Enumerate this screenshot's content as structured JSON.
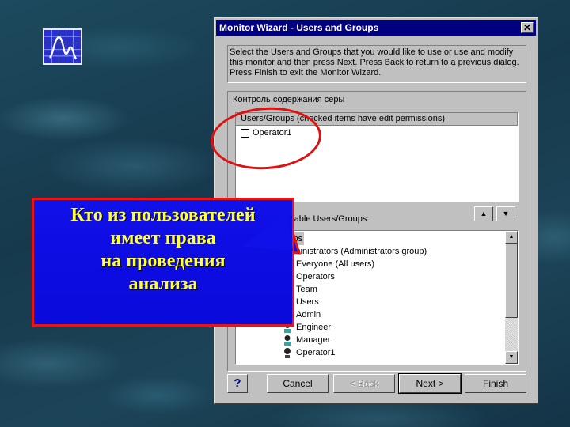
{
  "logo": {
    "icon": "waveform-chart-icon"
  },
  "dialog": {
    "title": "Monitor Wizard - Users and Groups",
    "close_label": "✕",
    "intro_lines": [
      "Select the Users and Groups that you would like to use or use and modify",
      "this monitor and then press Next.  Press Back to return to a previous dialog.",
      "Press Finish to exit the Monitor Wizard."
    ],
    "group_title": "Контроль содержания серы",
    "permissions": {
      "header": "Users/Groups  (checked items have edit permissions)",
      "items": [
        {
          "label": "Operator1",
          "checked": false
        }
      ]
    },
    "available_label": "Available Users/Groups:",
    "move_up_label": "▲",
    "move_down_label": "▼",
    "tree": {
      "items": [
        {
          "label": "Groups",
          "type": "folder",
          "selected": true
        },
        {
          "label": "Administrators (Administrators group)",
          "type": "group",
          "expander": "+"
        },
        {
          "label": "Everyone (All users)",
          "type": "group"
        },
        {
          "label": "Operators",
          "type": "group"
        },
        {
          "label": "Team",
          "type": "group"
        },
        {
          "label": "Users",
          "type": "group"
        },
        {
          "label": "Admin",
          "type": "user"
        },
        {
          "label": "Engineer",
          "type": "user"
        },
        {
          "label": "Manager",
          "type": "user"
        },
        {
          "label": "Operator1",
          "type": "user"
        }
      ]
    },
    "buttons": {
      "help": "?",
      "cancel": "Cancel",
      "back": "< Back",
      "next": "Next >",
      "finish": "Finish"
    }
  },
  "callout": {
    "lines": [
      "Кто из пользователей",
      "имеет права",
      "на проведения",
      "анализа"
    ],
    "text_color": "#ffff40",
    "bg_color": "#1010e8",
    "border_color": "#e01818"
  }
}
